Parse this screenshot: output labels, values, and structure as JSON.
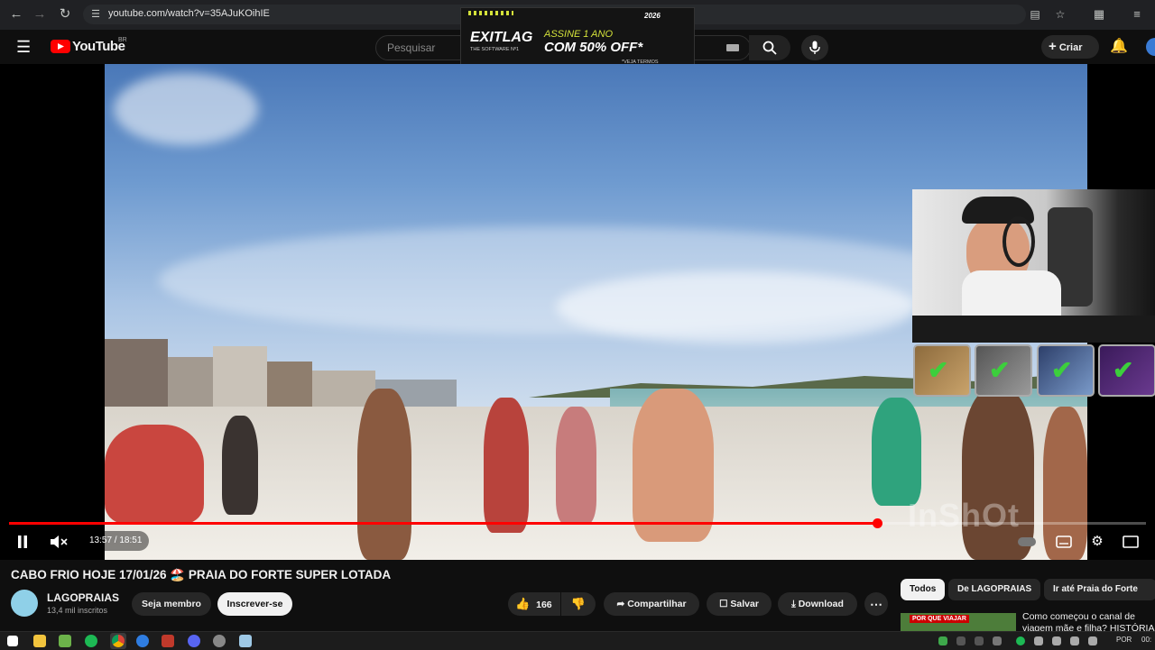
{
  "browser": {
    "url": "youtube.com/watch?v=35AJuKOihIE",
    "icons": [
      "back-arrow-icon",
      "forward-arrow-icon",
      "reload-icon",
      "site-info-icon",
      "cast-icon",
      "bookmark-star-icon",
      "extensions-icon",
      "tab-search-icon"
    ]
  },
  "header": {
    "logo_text": "YouTube",
    "region": "BR",
    "search_placeholder": "Pesquisar",
    "create_label": "Criar"
  },
  "ad": {
    "brand": "EXITLAG",
    "tagline": "THE SOFTWARE Nº1",
    "line1": "ASSINE 1 ANO",
    "line2": "COM 50% OFF*",
    "note": "*VEJA TERMOS",
    "badge": "2026"
  },
  "player": {
    "current_time": "13:57",
    "duration": "18:51",
    "progress": 0.7636,
    "watermark": "InShOt",
    "achievement_count": 4
  },
  "video": {
    "title": "CABO FRIO HOJE 17/01/26 🏖️ PRAIA DO FORTE SUPER LOTADA",
    "channel_name": "LAGOPRAIAS",
    "subscribers": "13,4 mil inscritos",
    "member_label": "Seja membro",
    "subscribe_label": "Inscrever-se",
    "likes": "166",
    "share_label": "Compartilhar",
    "save_label": "Salvar",
    "download_label": "Download"
  },
  "sidebar": {
    "chips": [
      "Todos",
      "De LAGOPRAIAS",
      "Ir até Praia do Forte"
    ],
    "suggestion_title": "Como começou o canal de viagem mãe e filha? HISTÓRIA",
    "suggestion_thumb_text": "POR QUE VIAJAR"
  },
  "taskbar": {
    "language": "POR",
    "clock": "00:"
  },
  "colors": {
    "accent": "#ff0000",
    "background": "#0f0f0f",
    "chip_active": "#f1f1f1"
  }
}
